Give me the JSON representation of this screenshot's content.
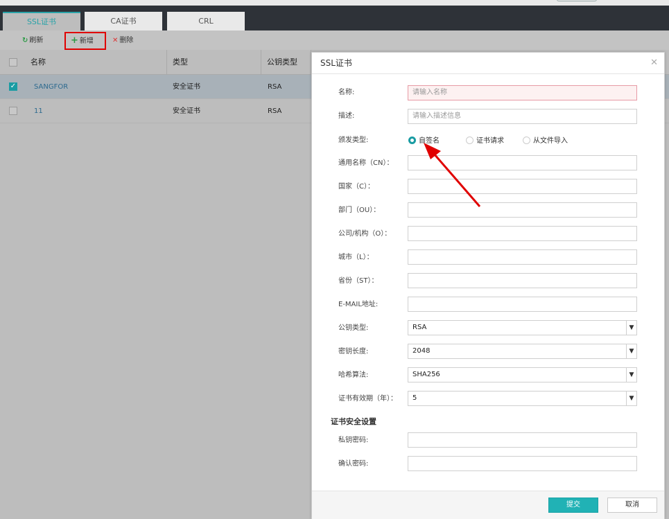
{
  "tabs": [
    {
      "label": "SSL证书"
    },
    {
      "label": "CA证书"
    },
    {
      "label": "CRL"
    }
  ],
  "toolbar": {
    "refresh_label": "刷新",
    "add_label": "新增",
    "delete_label": "删除"
  },
  "table": {
    "columns": [
      "名称",
      "类型",
      "公钥类型"
    ],
    "rows": [
      {
        "name": "SANGFOR",
        "type": "安全证书",
        "key_type": "RSA",
        "selected": true
      },
      {
        "name": "11",
        "type": "安全证书",
        "key_type": "RSA",
        "selected": false
      }
    ]
  },
  "dialog": {
    "title": "SSL证书",
    "name": {
      "label": "名称:",
      "placeholder": "请输入名称"
    },
    "desc": {
      "label": "描述:",
      "placeholder": "请输入描述信息"
    },
    "issue_type": {
      "label": "颁发类型:",
      "options": [
        "自签名",
        "证书请求",
        "从文件导入"
      ],
      "selected": "自签名"
    },
    "cn": {
      "label": "通用名称（CN）："
    },
    "country": {
      "label": "国家（C）："
    },
    "ou": {
      "label": "部门（OU）："
    },
    "org": {
      "label": "公司/机构（O）："
    },
    "city": {
      "label": "城市（L）："
    },
    "province": {
      "label": "省份（ST）："
    },
    "email": {
      "label": "E-MAIL地址:"
    },
    "key_type": {
      "label": "公钥类型:",
      "value": "RSA"
    },
    "key_length": {
      "label": "密钥长度:",
      "value": "2048"
    },
    "hash": {
      "label": "哈希算法:",
      "value": "SHA256"
    },
    "validity": {
      "label": "证书有效期（年）：",
      "value": "5"
    },
    "security_section": "证书安全设置",
    "private_pwd": {
      "label": "私钥密码:"
    },
    "confirm_pwd": {
      "label": "确认密码:"
    },
    "submit_label": "提交",
    "cancel_label": "取消"
  },
  "colors": {
    "accent": "#21b2b5",
    "highlight_red": "#e00000"
  }
}
